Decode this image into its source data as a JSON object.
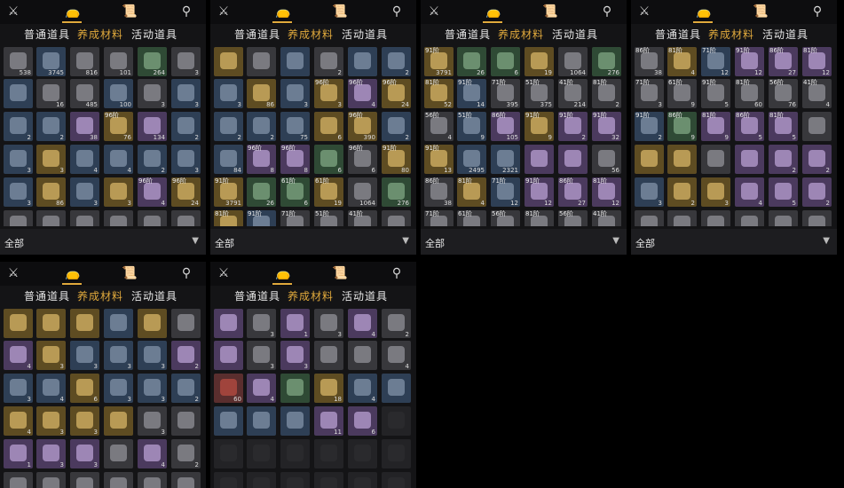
{
  "icons": [
    "crossed-swords-icon",
    "bag-icon",
    "scroll-icon",
    "map-pin-icon"
  ],
  "tabs": [
    "普通道具",
    "养成材料",
    "活动道具"
  ],
  "active_tab": 1,
  "filter_label": "全部",
  "colors": {
    "blue": "#2e3f55",
    "gold": "#5e4c22",
    "purple": "#4b3a5e",
    "gray": "#38383c",
    "green": "#2f4a35",
    "dark": "#232326",
    "red": "#5a2e2e"
  },
  "panels": [
    {
      "id": "p1",
      "show_tabs": true,
      "show_footer": true,
      "rows": [
        [
          {
            "c": "gray",
            "n": "538"
          },
          {
            "c": "blue",
            "n": "3745"
          },
          {
            "c": "gray",
            "n": "816"
          },
          {
            "c": "gray",
            "n": "101"
          },
          {
            "c": "green",
            "n": "264"
          },
          {
            "c": "gray",
            "n": "3"
          }
        ],
        [
          {
            "c": "blue",
            "n": ""
          },
          {
            "c": "gray",
            "n": "16"
          },
          {
            "c": "gray",
            "n": "485"
          },
          {
            "c": "blue",
            "n": "100"
          },
          {
            "c": "gray",
            "n": "3"
          },
          {
            "c": "blue",
            "n": "3"
          }
        ],
        [
          {
            "c": "blue",
            "n": "2"
          },
          {
            "c": "blue",
            "n": "2"
          },
          {
            "c": "purple",
            "n": "38"
          },
          {
            "c": "gold",
            "n": "76",
            "l": "96阶"
          },
          {
            "c": "purple",
            "n": "134"
          },
          {
            "c": "blue",
            "n": "2"
          }
        ],
        [
          {
            "c": "blue",
            "n": "3"
          },
          {
            "c": "gold",
            "n": "3"
          },
          {
            "c": "blue",
            "n": "4"
          },
          {
            "c": "blue",
            "n": "4"
          },
          {
            "c": "blue",
            "n": "2"
          },
          {
            "c": "blue",
            "n": "3"
          }
        ],
        [
          {
            "c": "blue",
            "n": "3"
          },
          {
            "c": "gold",
            "n": "86"
          },
          {
            "c": "blue",
            "n": "3"
          },
          {
            "c": "gold",
            "n": "3"
          },
          {
            "c": "purple",
            "n": "4",
            "l": "96阶"
          },
          {
            "c": "gold",
            "n": "24",
            "l": "96阶"
          }
        ],
        [
          {
            "c": "gray",
            "n": ""
          },
          {
            "c": "gray",
            "n": ""
          },
          {
            "c": "gray",
            "n": ""
          },
          {
            "c": "gray",
            "n": ""
          },
          {
            "c": "gray",
            "n": ""
          },
          {
            "c": "gray",
            "n": ""
          }
        ]
      ]
    },
    {
      "id": "p2",
      "show_tabs": true,
      "show_footer": true,
      "rows": [
        [
          {
            "c": "gold",
            "n": ""
          },
          {
            "c": "gray",
            "n": ""
          },
          {
            "c": "blue",
            "n": ""
          },
          {
            "c": "gray",
            "n": "2"
          },
          {
            "c": "blue",
            "n": ""
          },
          {
            "c": "blue",
            "n": "2"
          }
        ],
        [
          {
            "c": "blue",
            "n": "3"
          },
          {
            "c": "gold",
            "n": "86"
          },
          {
            "c": "blue",
            "n": "3"
          },
          {
            "c": "gold",
            "n": "3",
            "l": "96阶"
          },
          {
            "c": "purple",
            "n": "4",
            "l": "96阶"
          },
          {
            "c": "gold",
            "n": "24",
            "l": "96阶"
          }
        ],
        [
          {
            "c": "blue",
            "n": "2"
          },
          {
            "c": "blue",
            "n": "2"
          },
          {
            "c": "blue",
            "n": "75"
          },
          {
            "c": "gold",
            "n": "6"
          },
          {
            "c": "gold",
            "n": "390",
            "l": "96阶"
          },
          {
            "c": "blue",
            "n": "2"
          }
        ],
        [
          {
            "c": "blue",
            "n": "84"
          },
          {
            "c": "purple",
            "n": "8",
            "l": "96阶"
          },
          {
            "c": "purple",
            "n": "8",
            "l": "96阶"
          },
          {
            "c": "green",
            "n": "6"
          },
          {
            "c": "gray",
            "n": "6",
            "l": "96阶"
          },
          {
            "c": "gold",
            "n": "80",
            "l": "91阶"
          }
        ],
        [
          {
            "c": "gold",
            "n": "3791",
            "l": "91阶"
          },
          {
            "c": "green",
            "n": "26"
          },
          {
            "c": "green",
            "n": "6",
            "l": "61阶"
          },
          {
            "c": "gold",
            "n": "19",
            "l": "61阶"
          },
          {
            "c": "gray",
            "n": "1064"
          },
          {
            "c": "green",
            "n": "276"
          }
        ],
        [
          {
            "c": "gold",
            "n": "",
            "l": "81阶"
          },
          {
            "c": "blue",
            "n": "",
            "l": "91阶"
          },
          {
            "c": "gray",
            "n": "",
            "l": "71阶"
          },
          {
            "c": "gray",
            "n": "",
            "l": "51阶"
          },
          {
            "c": "gray",
            "n": "",
            "l": "41阶"
          },
          {
            "c": "gray",
            "n": ""
          }
        ]
      ]
    },
    {
      "id": "p3",
      "show_tabs": true,
      "show_footer": true,
      "rows": [
        [
          {
            "c": "gold",
            "n": "3791",
            "l": "91阶"
          },
          {
            "c": "green",
            "n": "26"
          },
          {
            "c": "green",
            "n": "6"
          },
          {
            "c": "gold",
            "n": "19"
          },
          {
            "c": "gray",
            "n": "1064"
          },
          {
            "c": "green",
            "n": "276"
          }
        ],
        [
          {
            "c": "gold",
            "n": "52",
            "l": "81阶"
          },
          {
            "c": "blue",
            "n": "14",
            "l": "91阶"
          },
          {
            "c": "gray",
            "n": "395",
            "l": "71阶"
          },
          {
            "c": "gray",
            "n": "375",
            "l": "51阶"
          },
          {
            "c": "gray",
            "n": "214",
            "l": "41阶"
          },
          {
            "c": "gray",
            "n": "2",
            "l": "81阶"
          }
        ],
        [
          {
            "c": "gray",
            "n": "4",
            "l": "56阶"
          },
          {
            "c": "blue",
            "n": "9",
            "l": "51阶"
          },
          {
            "c": "purple",
            "n": "105",
            "l": "86阶"
          },
          {
            "c": "gold",
            "n": "9",
            "l": "91阶"
          },
          {
            "c": "purple",
            "n": "2",
            "l": "91阶"
          },
          {
            "c": "purple",
            "n": "32",
            "l": "91阶"
          }
        ],
        [
          {
            "c": "gold",
            "n": "13",
            "l": "91阶"
          },
          {
            "c": "blue",
            "n": "2495"
          },
          {
            "c": "blue",
            "n": "2321"
          },
          {
            "c": "purple",
            "n": ""
          },
          {
            "c": "purple",
            "n": ""
          },
          {
            "c": "gray",
            "n": "56"
          }
        ],
        [
          {
            "c": "gray",
            "n": "38",
            "l": "86阶"
          },
          {
            "c": "gold",
            "n": "4",
            "l": "81阶"
          },
          {
            "c": "blue",
            "n": "12",
            "l": "71阶"
          },
          {
            "c": "purple",
            "n": "12",
            "l": "91阶"
          },
          {
            "c": "purple",
            "n": "27",
            "l": "86阶"
          },
          {
            "c": "purple",
            "n": "12",
            "l": "81阶"
          }
        ],
        [
          {
            "c": "gray",
            "n": "",
            "l": "71阶"
          },
          {
            "c": "gray",
            "n": "",
            "l": "61阶"
          },
          {
            "c": "gray",
            "n": "",
            "l": "56阶"
          },
          {
            "c": "gray",
            "n": "",
            "l": "81阶"
          },
          {
            "c": "gray",
            "n": "",
            "l": "56阶"
          },
          {
            "c": "gray",
            "n": "",
            "l": "41阶"
          }
        ]
      ]
    },
    {
      "id": "p4",
      "show_tabs": true,
      "show_footer": true,
      "rows": [
        [
          {
            "c": "gray",
            "n": "38",
            "l": "86阶"
          },
          {
            "c": "gold",
            "n": "4",
            "l": "81阶"
          },
          {
            "c": "blue",
            "n": "12",
            "l": "71阶"
          },
          {
            "c": "purple",
            "n": "12",
            "l": "91阶"
          },
          {
            "c": "purple",
            "n": "27",
            "l": "86阶"
          },
          {
            "c": "purple",
            "n": "12",
            "l": "81阶"
          }
        ],
        [
          {
            "c": "gray",
            "n": "3",
            "l": "71阶"
          },
          {
            "c": "gray",
            "n": "9",
            "l": "61阶"
          },
          {
            "c": "gray",
            "n": "5",
            "l": "91阶"
          },
          {
            "c": "gray",
            "n": "60",
            "l": "81阶"
          },
          {
            "c": "gray",
            "n": "76",
            "l": "56阶"
          },
          {
            "c": "gray",
            "n": "4",
            "l": "41阶"
          }
        ],
        [
          {
            "c": "blue",
            "n": "2",
            "l": "91阶"
          },
          {
            "c": "green",
            "n": "9",
            "l": "86阶"
          },
          {
            "c": "purple",
            "n": "9",
            "l": "81阶"
          },
          {
            "c": "purple",
            "n": "5",
            "l": "86阶"
          },
          {
            "c": "purple",
            "n": "5",
            "l": "81阶"
          },
          {
            "c": "gray",
            "n": ""
          }
        ],
        [
          {
            "c": "gold",
            "n": ""
          },
          {
            "c": "gold",
            "n": ""
          },
          {
            "c": "gray",
            "n": ""
          },
          {
            "c": "purple",
            "n": ""
          },
          {
            "c": "purple",
            "n": "2"
          },
          {
            "c": "purple",
            "n": "2"
          }
        ],
        [
          {
            "c": "blue",
            "n": "3"
          },
          {
            "c": "gold",
            "n": "2"
          },
          {
            "c": "gold",
            "n": "3"
          },
          {
            "c": "purple",
            "n": "4"
          },
          {
            "c": "purple",
            "n": "5"
          },
          {
            "c": "purple",
            "n": "2"
          }
        ],
        [
          {
            "c": "gray",
            "n": ""
          },
          {
            "c": "gray",
            "n": ""
          },
          {
            "c": "gray",
            "n": ""
          },
          {
            "c": "gray",
            "n": ""
          },
          {
            "c": "gray",
            "n": ""
          },
          {
            "c": "gray",
            "n": ""
          }
        ]
      ]
    },
    {
      "id": "p5",
      "show_tabs": true,
      "show_footer": false,
      "rows": [
        [
          {
            "c": "gold",
            "n": ""
          },
          {
            "c": "gold",
            "n": ""
          },
          {
            "c": "gold",
            "n": ""
          },
          {
            "c": "blue",
            "n": ""
          },
          {
            "c": "gold",
            "n": ""
          },
          {
            "c": "gray",
            "n": ""
          }
        ],
        [
          {
            "c": "purple",
            "n": "4"
          },
          {
            "c": "gold",
            "n": "3"
          },
          {
            "c": "blue",
            "n": "3"
          },
          {
            "c": "blue",
            "n": "3"
          },
          {
            "c": "blue",
            "n": "3"
          },
          {
            "c": "purple",
            "n": "2"
          }
        ],
        [
          {
            "c": "blue",
            "n": "3"
          },
          {
            "c": "blue",
            "n": "4"
          },
          {
            "c": "gold",
            "n": "6"
          },
          {
            "c": "blue",
            "n": "3"
          },
          {
            "c": "blue",
            "n": "3"
          },
          {
            "c": "blue",
            "n": "2"
          }
        ],
        [
          {
            "c": "gold",
            "n": "4"
          },
          {
            "c": "gold",
            "n": "3"
          },
          {
            "c": "gold",
            "n": "3"
          },
          {
            "c": "gold",
            "n": ""
          },
          {
            "c": "gray",
            "n": "3"
          },
          {
            "c": "gray",
            "n": ""
          }
        ],
        [
          {
            "c": "purple",
            "n": "1"
          },
          {
            "c": "purple",
            "n": "3"
          },
          {
            "c": "purple",
            "n": "3"
          },
          {
            "c": "gray",
            "n": ""
          },
          {
            "c": "purple",
            "n": "4"
          },
          {
            "c": "gray",
            "n": "2"
          }
        ],
        [
          {
            "c": "gray",
            "n": ""
          },
          {
            "c": "gray",
            "n": ""
          },
          {
            "c": "gray",
            "n": ""
          },
          {
            "c": "gray",
            "n": ""
          },
          {
            "c": "gray",
            "n": ""
          },
          {
            "c": "gray",
            "n": ""
          }
        ]
      ]
    },
    {
      "id": "p6",
      "show_tabs": true,
      "show_footer": false,
      "rows": [
        [
          {
            "c": "purple",
            "n": ""
          },
          {
            "c": "gray",
            "n": "3"
          },
          {
            "c": "purple",
            "n": "1"
          },
          {
            "c": "gray",
            "n": "3"
          },
          {
            "c": "purple",
            "n": "4"
          },
          {
            "c": "gray",
            "n": "2"
          }
        ],
        [
          {
            "c": "purple",
            "n": ""
          },
          {
            "c": "gray",
            "n": "3"
          },
          {
            "c": "purple",
            "n": "3"
          },
          {
            "c": "gray",
            "n": ""
          },
          {
            "c": "gray",
            "n": ""
          },
          {
            "c": "gray",
            "n": "4"
          }
        ],
        [
          {
            "c": "red",
            "n": "60"
          },
          {
            "c": "purple",
            "n": "4"
          },
          {
            "c": "green",
            "n": ""
          },
          {
            "c": "gold",
            "n": "18"
          },
          {
            "c": "blue",
            "n": "4"
          },
          {
            "c": "blue",
            "n": ""
          }
        ],
        [
          {
            "c": "blue",
            "n": ""
          },
          {
            "c": "blue",
            "n": ""
          },
          {
            "c": "blue",
            "n": ""
          },
          {
            "c": "purple",
            "n": "11"
          },
          {
            "c": "purple",
            "n": "6"
          },
          {
            "c": "dark",
            "n": ""
          }
        ],
        [
          {
            "c": "dark",
            "n": ""
          },
          {
            "c": "dark",
            "n": ""
          },
          {
            "c": "dark",
            "n": ""
          },
          {
            "c": "dark",
            "n": ""
          },
          {
            "c": "dark",
            "n": ""
          },
          {
            "c": "dark",
            "n": ""
          }
        ],
        [
          {
            "c": "dark",
            "n": ""
          },
          {
            "c": "dark",
            "n": ""
          },
          {
            "c": "dark",
            "n": ""
          },
          {
            "c": "dark",
            "n": ""
          },
          {
            "c": "dark",
            "n": ""
          },
          {
            "c": "dark",
            "n": ""
          }
        ]
      ]
    }
  ]
}
